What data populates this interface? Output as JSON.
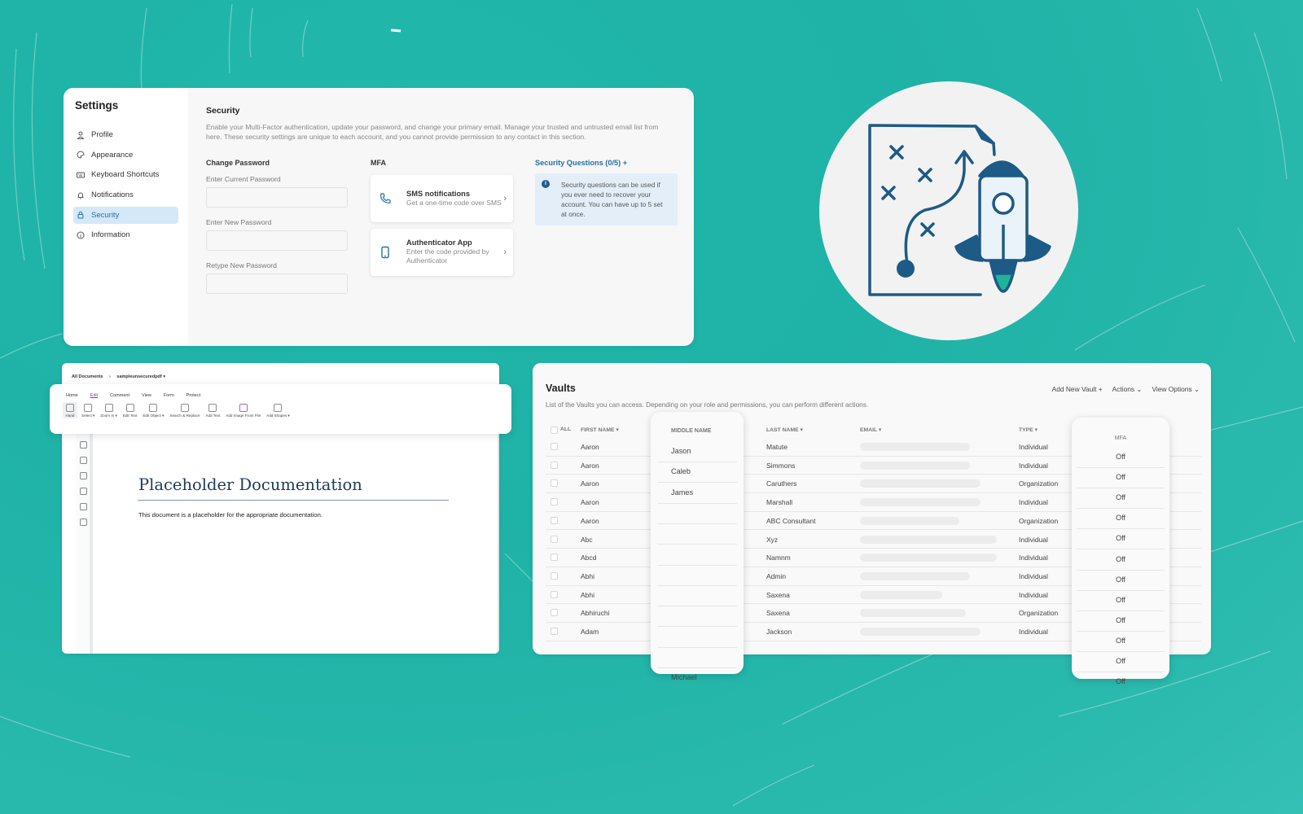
{
  "settings": {
    "title": "Settings",
    "nav": [
      {
        "label": "Profile",
        "icon": "user-icon"
      },
      {
        "label": "Appearance",
        "icon": "palette-icon"
      },
      {
        "label": "Keyboard Shortcuts",
        "icon": "keyboard-icon"
      },
      {
        "label": "Notifications",
        "icon": "bell-icon"
      },
      {
        "label": "Security",
        "icon": "lock-icon",
        "active": true
      },
      {
        "label": "Information",
        "icon": "info-icon"
      }
    ],
    "security": {
      "title": "Security",
      "description": "Enable your Multi-Factor authentication, update your password, and change your primary email. Manage your trusted and untrusted email list from here. These security settings are unique to each account, and you cannot provide permission to any contact in this section.",
      "change_password": {
        "heading": "Change Password",
        "fields": [
          {
            "label": "Enter Current Password",
            "value": ""
          },
          {
            "label": "Enter New Password",
            "value": ""
          },
          {
            "label": "Retype New Password",
            "value": ""
          }
        ]
      },
      "mfa": {
        "heading": "MFA",
        "options": [
          {
            "title": "SMS notifications",
            "subtitle": "Get a one-time code over SMS",
            "icon": "phone-icon"
          },
          {
            "title": "Authenticator App",
            "subtitle": "Enter the code provided by Authenticator",
            "icon": "smartphone-icon"
          }
        ]
      },
      "security_questions": {
        "link": "Security Questions (0/5) +",
        "info": "Security questions can be used if you ever need to recover your account. You can have up to 5 set at once."
      }
    }
  },
  "illustration": {
    "icon": "strategy-map-rocket-illustration"
  },
  "pdf_editor": {
    "breadcrumb": [
      "All Documents",
      "›",
      "sampleunsecuredpdf ▾"
    ],
    "tabs": [
      "Home",
      "Edit",
      "Comment",
      "View",
      "Form",
      "Protect"
    ],
    "active_tab": "Edit",
    "tools": [
      {
        "label": "Hand",
        "icon": "hand-icon"
      },
      {
        "label": "Select ▾",
        "icon": "select-text-icon"
      },
      {
        "label": "Zoom In ▾",
        "icon": "zoom-in-icon"
      },
      {
        "label": "Edit Text",
        "icon": "edit-text-icon"
      },
      {
        "label": "Edit Object ▾",
        "icon": "edit-object-icon"
      },
      {
        "label": "Search & Replace",
        "icon": "search-replace-icon"
      },
      {
        "label": "Add Text",
        "icon": "add-text-icon"
      },
      {
        "label": "Add Image From File",
        "icon": "add-image-icon"
      },
      {
        "label": "Add Shapes ▾",
        "icon": "add-shapes-icon"
      }
    ],
    "sidebar_icons": [
      "bookmark-icon",
      "pages-icon",
      "comments-icon",
      "layers-icon",
      "attachment-icon",
      "document-icon"
    ],
    "document": {
      "title": "Placeholder Documentation",
      "body": "This document is a placeholder for the appropriate documentation."
    }
  },
  "vaults": {
    "title": "Vaults",
    "description": "List of the Vaults you can access. Depending on your role and permissions, you can perform different actions.",
    "actions": [
      "Add New Vault +",
      "Actions ⌄",
      "View Options ⌄"
    ],
    "columns": {
      "all": "ALL",
      "first": "FIRST NAME ▾",
      "middle": "MIDDLE NAME",
      "last": "LAST NAME ▾",
      "email": "EMAIL ▾",
      "type": "TYPE ▾",
      "mfa": "MFA"
    },
    "rows": [
      {
        "first": "Aaron",
        "middle": "Jason",
        "last": "Matute",
        "type": "Individual",
        "mfa": "Off"
      },
      {
        "first": "Aaron",
        "middle": "Caleb",
        "last": "Simmons",
        "type": "Individual",
        "mfa": "Off"
      },
      {
        "first": "Aaron",
        "middle": "James",
        "last": "Caruthers",
        "type": "Organization",
        "mfa": "Off"
      },
      {
        "first": "Aaron",
        "middle": "",
        "last": "Marshall",
        "type": "Individual",
        "mfa": "Off"
      },
      {
        "first": "Aaron",
        "middle": "",
        "last": "ABC Consultant",
        "type": "Organization",
        "mfa": "Off"
      },
      {
        "first": "Abc",
        "middle": "",
        "last": "Xyz",
        "type": "Individual",
        "mfa": "Off"
      },
      {
        "first": "Abcd",
        "middle": "",
        "last": "Namnm",
        "type": "Individual",
        "mfa": "Off"
      },
      {
        "first": "Abhi",
        "middle": "",
        "last": "Admin",
        "type": "Individual",
        "mfa": "Off"
      },
      {
        "first": "Abhi",
        "middle": "",
        "last": "Saxena",
        "type": "Individual",
        "mfa": "Off"
      },
      {
        "first": "Abhiruchi",
        "middle": "",
        "last": "Saxena",
        "type": "Organization",
        "mfa": "Off"
      },
      {
        "first": "Adam",
        "middle": "",
        "last": "Jackson",
        "type": "Individual",
        "mfa": "Off"
      }
    ],
    "extra_middle": "Michael",
    "extra_mfa": "Off"
  },
  "colors": {
    "background": "#1fb2a6",
    "accent": "#2a6ea3",
    "illustration_dark": "#1d5a86",
    "illustration_teal": "#1fb39a"
  }
}
